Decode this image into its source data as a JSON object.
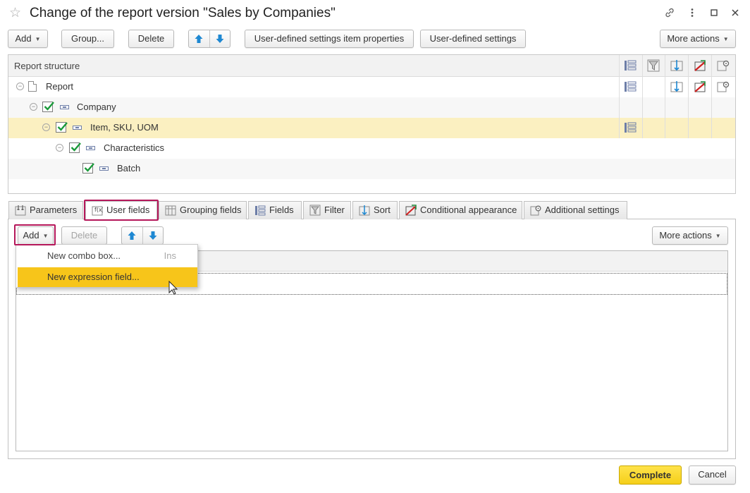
{
  "window": {
    "title": "Change of the report version \"Sales by Companies\""
  },
  "toolbar": {
    "add_label": "Add",
    "group_label": "Group...",
    "delete_label": "Delete",
    "item_props_label": "User-defined settings item properties",
    "user_settings_label": "User-defined settings",
    "more_actions_label": "More actions"
  },
  "structure": {
    "header_label": "Report structure",
    "rows": [
      {
        "label": "Report"
      },
      {
        "label": "Company",
        "checked": true
      },
      {
        "label": "Item, SKU, UOM",
        "checked": true,
        "selected": true
      },
      {
        "label": "Characteristics",
        "checked": true
      },
      {
        "label": "Batch",
        "checked": true
      }
    ]
  },
  "tabs": [
    {
      "label": "Parameters",
      "icon": "parameters-icon"
    },
    {
      "label": "User fields",
      "icon": "user-fields-icon",
      "active": true
    },
    {
      "label": "Grouping fields",
      "icon": "grouping-fields-icon"
    },
    {
      "label": "Fields",
      "icon": "fields-icon"
    },
    {
      "label": "Filter",
      "icon": "filter-icon"
    },
    {
      "label": "Sort",
      "icon": "sort-icon"
    },
    {
      "label": "Conditional appearance",
      "icon": "conditional-appearance-icon"
    },
    {
      "label": "Additional settings",
      "icon": "additional-settings-icon"
    }
  ],
  "panel_toolbar": {
    "add_label": "Add",
    "delete_label": "Delete",
    "more_actions_label": "More actions"
  },
  "dropdown": {
    "items": [
      {
        "label": "New combo box...",
        "shortcut": "Ins"
      },
      {
        "label": "New expression field...",
        "selected": true
      }
    ]
  },
  "footer": {
    "complete_label": "Complete",
    "cancel_label": "Cancel"
  },
  "colors": {
    "accent_yellow": "#f7c51a",
    "selection_row": "#fbf0c1",
    "highlight_frame": "#b5175a",
    "arrow_blue": "#1e88d2",
    "check_green": "#1a9a3a"
  }
}
